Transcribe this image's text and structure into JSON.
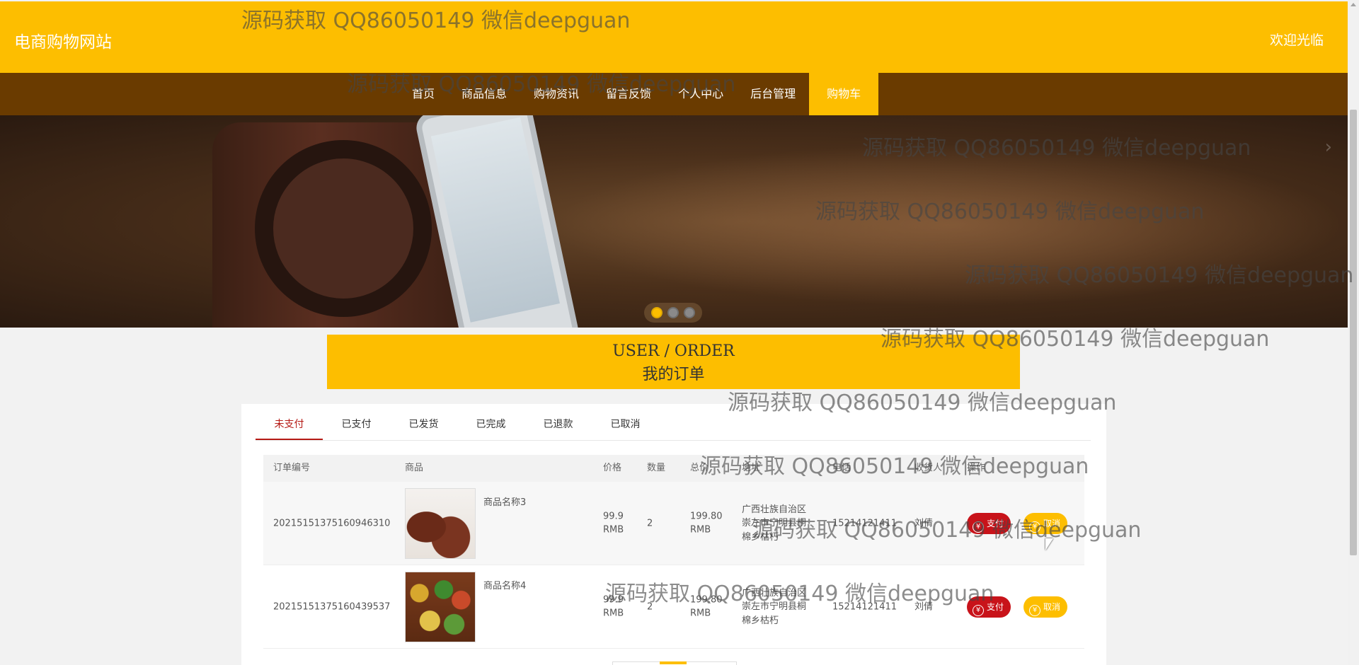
{
  "header": {
    "site_title": "电商购物网站",
    "welcome": "欢迎光临"
  },
  "nav": {
    "items": [
      "首页",
      "商品信息",
      "购物资讯",
      "留言反馈",
      "个人中心",
      "后台管理",
      "购物车"
    ],
    "active_index": 6
  },
  "banner": {
    "slides": 3,
    "active_slide": 0
  },
  "order_title": {
    "en": "USER / ORDER",
    "cn": "我的订单"
  },
  "tabs": {
    "items": [
      "未支付",
      "已支付",
      "已发货",
      "已完成",
      "已退款",
      "已取消"
    ],
    "active_index": 0
  },
  "table": {
    "headers": [
      "订单编号",
      "商品",
      "价格",
      "数量",
      "总价",
      "地址",
      "电话",
      "收货人",
      "操作"
    ],
    "rows": [
      {
        "order_no": "20215151375160946310",
        "product_name": "商品名称3",
        "price": "99.9",
        "price_unit": "RMB",
        "qty": "2",
        "total": "199.80",
        "total_unit": "RMB",
        "address_l1": "广西壮族自治区",
        "address_l2": "崇左市宁明县桐",
        "address_l3": "棉乡枯朽",
        "phone": "15214121411",
        "receiver": "刘倩",
        "pay_label": "支付",
        "cancel_label": "取消"
      },
      {
        "order_no": "20215151375160439537",
        "product_name": "商品名称4",
        "price": "99.9",
        "price_unit": "RMB",
        "qty": "2",
        "total": "199.80",
        "total_unit": "RMB",
        "address_l1": "广西壮族自治区",
        "address_l2": "崇左市宁明县桐",
        "address_l3": "棉乡枯朽",
        "phone": "15214121411",
        "receiver": "刘倩",
        "pay_label": "支付",
        "cancel_label": "取消"
      }
    ]
  },
  "watermark": "源码获取 QQ86050149 微信deepguan",
  "colors": {
    "brand_yellow": "#fdbe00",
    "nav_brown": "#6a3b00",
    "pay_red": "#c8131a",
    "tab_active": "#b51a15"
  }
}
